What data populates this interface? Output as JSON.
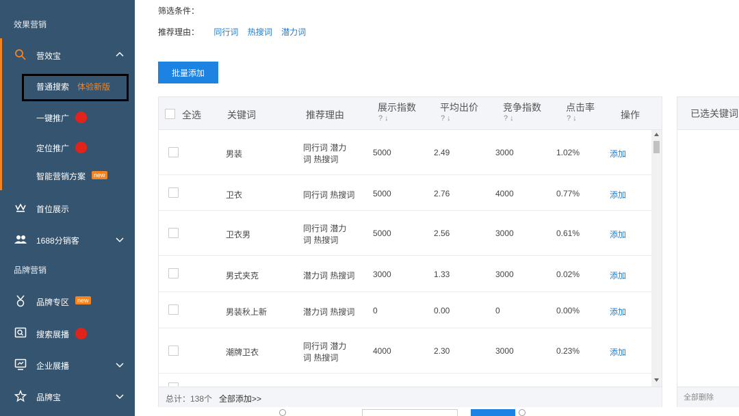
{
  "sidebar": {
    "section_effect": "效果营销",
    "yingxiaobao": "营效宝",
    "sub_items": {
      "normal_search": "普通搜索",
      "try_new": "体验新版",
      "one_click": "一键推广",
      "targeting": "定位推广",
      "smart_plan": "智能营销方案",
      "new_badge": "new"
    },
    "top_display": "首位展示",
    "distributor": "1688分销客",
    "section_brand": "品牌营销",
    "brand_zone": "品牌专区",
    "brand_zone_badge": "new",
    "search_display": "搜索展播",
    "enterprise_display": "企业展播",
    "brand_bao": "品牌宝"
  },
  "filters": {
    "filter_label": "筛选条件：",
    "reason_label": "推荐理由：",
    "reasons": [
      "同行词",
      "热搜词",
      "潜力词"
    ]
  },
  "batch_add_label": "批量添加",
  "table": {
    "headers": {
      "select_all": "全选",
      "keyword": "关键词",
      "reason": "推荐理由",
      "impressions": "展示指数",
      "avg_bid": "平均出价",
      "competition": "竞争指数",
      "ctr": "点击率",
      "action": "操作"
    },
    "sort_hint": "? ↓",
    "rows": [
      {
        "keyword": "男装",
        "reason1": "同行词 潜力",
        "reason2": "词 热搜词",
        "impressions": "5000",
        "bid": "2.49",
        "competition": "3000",
        "ctr": "1.02%",
        "action": "添加"
      },
      {
        "keyword": "卫衣",
        "reason1": "同行词 热搜词",
        "reason2": "",
        "impressions": "5000",
        "bid": "2.76",
        "competition": "4000",
        "ctr": "0.77%",
        "action": "添加"
      },
      {
        "keyword": "卫衣男",
        "reason1": "同行词 潜力",
        "reason2": "词 热搜词",
        "impressions": "5000",
        "bid": "2.56",
        "competition": "3000",
        "ctr": "0.61%",
        "action": "添加"
      },
      {
        "keyword": "男式夹克",
        "reason1": "潜力词 热搜词",
        "reason2": "",
        "impressions": "3000",
        "bid": "1.33",
        "competition": "3000",
        "ctr": "0.02%",
        "action": "添加"
      },
      {
        "keyword": "男装秋上新",
        "reason1": "潜力词 热搜词",
        "reason2": "",
        "impressions": "0",
        "bid": "0.00",
        "competition": "0",
        "ctr": "0.00%",
        "action": "添加"
      },
      {
        "keyword": "潮牌卫衣",
        "reason1": "同行词 潜力",
        "reason2": "词 热搜词",
        "impressions": "4000",
        "bid": "2.30",
        "competition": "3000",
        "ctr": "0.23%",
        "action": "添加"
      }
    ],
    "footer_total": "总计：138个",
    "footer_add_all": "全部添加>>"
  },
  "selected_panel": {
    "title": "已选关键词",
    "clear_all": "全部删除"
  },
  "colors": {
    "sidebar_bg": "#35546f",
    "accent_orange": "#f5841f",
    "primary_blue": "#1d83e3",
    "link_blue": "#1a7dd7"
  }
}
